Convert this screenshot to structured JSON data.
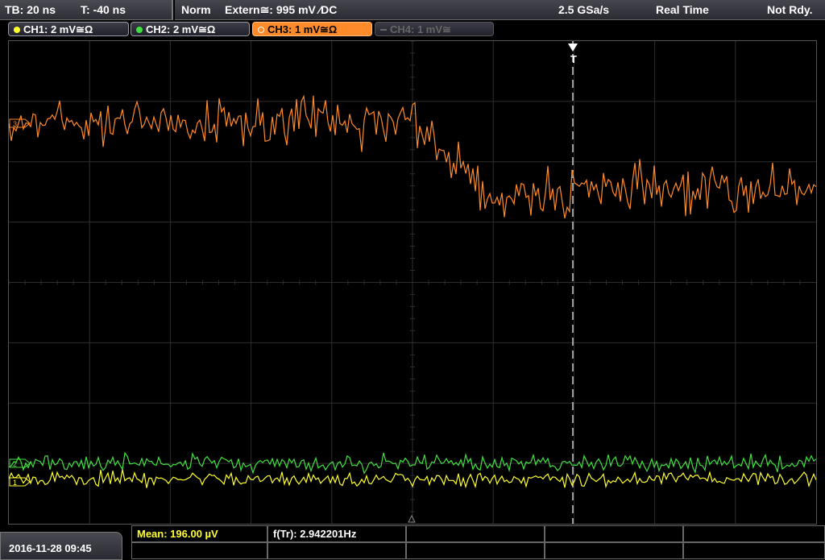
{
  "header": {
    "timebase": "TB: 20 ns",
    "trigger_time": "T: -40 ns",
    "mode": "Norm",
    "trigger_source": "Extern≅: 995 mV ⁄DC",
    "sample_rate": "2.5 GSa/s",
    "acq_mode": "Real Time",
    "status": "Not Rdy."
  },
  "channels": [
    {
      "label": "CH1: 2 mV≅Ω",
      "color": "#ffff30",
      "state": "on"
    },
    {
      "label": "CH2: 2 mV≅Ω",
      "color": "#40e040",
      "state": "on"
    },
    {
      "label": "CH3: 1 mV≅Ω",
      "color": "#ff8a2a",
      "state": "active"
    },
    {
      "label": "CH4: 1 mV≅",
      "color": "#666666",
      "state": "off"
    }
  ],
  "markers": {
    "ch3": "3",
    "ch2": "2",
    "ch1": "1",
    "trigger": "T"
  },
  "measurements": {
    "mean": "Mean: 196.00 µV",
    "freq": "f(Tr): 2.942201Hz"
  },
  "datetime": "2016-11-28 09:45",
  "colors": {
    "grid": "#2e2e2e",
    "ch1": "#ffff30",
    "ch2": "#40e040",
    "ch3": "#ff8a2a"
  }
}
